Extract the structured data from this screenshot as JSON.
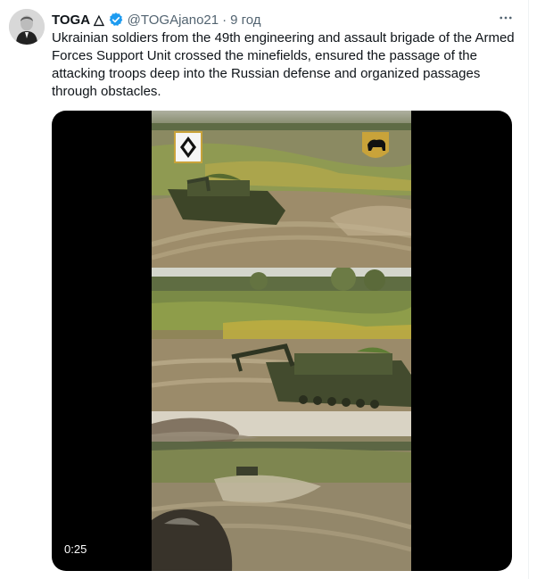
{
  "tweet": {
    "author_name": "TOGA",
    "author_symbol": "△",
    "handle": "@TOGAjano21",
    "separator": "·",
    "timestamp": "9 год",
    "text": "Ukrainian soldiers from the 49th engineering and assault brigade of the Armed Forces Support Unit crossed the minefields, ensured the passage of the attacking troops deep into the Russian defense and organized passages through obstacles."
  },
  "icons": {
    "verified": "verified-badge-icon",
    "more": "more-options-icon"
  },
  "video": {
    "duration": "0:25"
  },
  "colors": {
    "verified_blue": "#1d9bf0",
    "secondary_text": "#536471",
    "primary_text": "#0f1419"
  }
}
